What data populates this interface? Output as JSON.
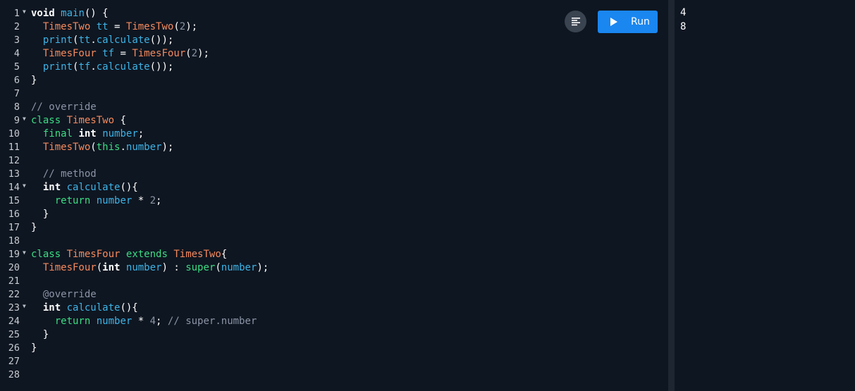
{
  "editor": {
    "lines": [
      {
        "n": "1",
        "fold": true,
        "tokens": [
          [
            "kw",
            "void"
          ],
          [
            "pl",
            " "
          ],
          [
            "fn",
            "main"
          ],
          [
            "pl",
            "() {"
          ]
        ]
      },
      {
        "n": "2",
        "fold": false,
        "tokens": [
          [
            "pl",
            "  "
          ],
          [
            "ty",
            "TimesTwo"
          ],
          [
            "pl",
            " "
          ],
          [
            "id",
            "tt"
          ],
          [
            "pl",
            " = "
          ],
          [
            "ty",
            "TimesTwo"
          ],
          [
            "pl",
            "("
          ],
          [
            "num",
            "2"
          ],
          [
            "pl",
            ");"
          ]
        ]
      },
      {
        "n": "3",
        "fold": false,
        "tokens": [
          [
            "pl",
            "  "
          ],
          [
            "fn",
            "print"
          ],
          [
            "pl",
            "("
          ],
          [
            "id",
            "tt"
          ],
          [
            "pl",
            "."
          ],
          [
            "fn",
            "calculate"
          ],
          [
            "pl",
            "());"
          ]
        ]
      },
      {
        "n": "4",
        "fold": false,
        "tokens": [
          [
            "pl",
            "  "
          ],
          [
            "ty",
            "TimesFour"
          ],
          [
            "pl",
            " "
          ],
          [
            "id",
            "tf"
          ],
          [
            "pl",
            " = "
          ],
          [
            "ty",
            "TimesFour"
          ],
          [
            "pl",
            "("
          ],
          [
            "num",
            "2"
          ],
          [
            "pl",
            ");"
          ]
        ]
      },
      {
        "n": "5",
        "fold": false,
        "tokens": [
          [
            "pl",
            "  "
          ],
          [
            "fn",
            "print"
          ],
          [
            "pl",
            "("
          ],
          [
            "id",
            "tf"
          ],
          [
            "pl",
            "."
          ],
          [
            "fn",
            "calculate"
          ],
          [
            "pl",
            "());"
          ]
        ]
      },
      {
        "n": "6",
        "fold": false,
        "tokens": [
          [
            "pl",
            "}"
          ]
        ]
      },
      {
        "n": "7",
        "fold": false,
        "tokens": []
      },
      {
        "n": "8",
        "fold": false,
        "tokens": [
          [
            "cm",
            "// override"
          ]
        ]
      },
      {
        "n": "9",
        "fold": true,
        "tokens": [
          [
            "kw2",
            "class"
          ],
          [
            "pl",
            " "
          ],
          [
            "ty",
            "TimesTwo"
          ],
          [
            "pl",
            " {"
          ]
        ]
      },
      {
        "n": "10",
        "fold": false,
        "tokens": [
          [
            "pl",
            "  "
          ],
          [
            "kw2",
            "final"
          ],
          [
            "pl",
            " "
          ],
          [
            "kw",
            "int"
          ],
          [
            "pl",
            " "
          ],
          [
            "id",
            "number"
          ],
          [
            "pl",
            ";"
          ]
        ]
      },
      {
        "n": "11",
        "fold": false,
        "tokens": [
          [
            "pl",
            "  "
          ],
          [
            "ty",
            "TimesTwo"
          ],
          [
            "pl",
            "("
          ],
          [
            "kw2",
            "this"
          ],
          [
            "pl",
            "."
          ],
          [
            "id",
            "number"
          ],
          [
            "pl",
            ");"
          ]
        ]
      },
      {
        "n": "12",
        "fold": false,
        "tokens": []
      },
      {
        "n": "13",
        "fold": false,
        "tokens": [
          [
            "pl",
            "  "
          ],
          [
            "cm",
            "// method"
          ]
        ]
      },
      {
        "n": "14",
        "fold": true,
        "tokens": [
          [
            "pl",
            "  "
          ],
          [
            "kw",
            "int"
          ],
          [
            "pl",
            " "
          ],
          [
            "fn",
            "calculate"
          ],
          [
            "pl",
            "(){"
          ]
        ]
      },
      {
        "n": "15",
        "fold": false,
        "tokens": [
          [
            "pl",
            "    "
          ],
          [
            "kw2",
            "return"
          ],
          [
            "pl",
            " "
          ],
          [
            "id",
            "number"
          ],
          [
            "pl",
            " * "
          ],
          [
            "num",
            "2"
          ],
          [
            "pl",
            ";"
          ]
        ]
      },
      {
        "n": "16",
        "fold": false,
        "tokens": [
          [
            "pl",
            "  }"
          ]
        ]
      },
      {
        "n": "17",
        "fold": false,
        "tokens": [
          [
            "pl",
            "}"
          ]
        ]
      },
      {
        "n": "18",
        "fold": false,
        "tokens": []
      },
      {
        "n": "19",
        "fold": true,
        "tokens": [
          [
            "kw2",
            "class"
          ],
          [
            "pl",
            " "
          ],
          [
            "ty",
            "TimesFour"
          ],
          [
            "pl",
            " "
          ],
          [
            "kw2",
            "extends"
          ],
          [
            "pl",
            " "
          ],
          [
            "ty",
            "TimesTwo"
          ],
          [
            "pl",
            "{"
          ]
        ]
      },
      {
        "n": "20",
        "fold": false,
        "tokens": [
          [
            "pl",
            "  "
          ],
          [
            "ty",
            "TimesFour"
          ],
          [
            "pl",
            "("
          ],
          [
            "kw",
            "int"
          ],
          [
            "pl",
            " "
          ],
          [
            "id",
            "number"
          ],
          [
            "pl",
            ") : "
          ],
          [
            "kw2",
            "super"
          ],
          [
            "pl",
            "("
          ],
          [
            "id",
            "number"
          ],
          [
            "pl",
            ");"
          ]
        ]
      },
      {
        "n": "21",
        "fold": false,
        "tokens": []
      },
      {
        "n": "22",
        "fold": false,
        "tokens": [
          [
            "pl",
            "  "
          ],
          [
            "an",
            "@override"
          ]
        ]
      },
      {
        "n": "23",
        "fold": true,
        "tokens": [
          [
            "pl",
            "  "
          ],
          [
            "kw",
            "int"
          ],
          [
            "pl",
            " "
          ],
          [
            "fn",
            "calculate"
          ],
          [
            "pl",
            "(){"
          ]
        ]
      },
      {
        "n": "24",
        "fold": false,
        "tokens": [
          [
            "pl",
            "    "
          ],
          [
            "kw2",
            "return"
          ],
          [
            "pl",
            " "
          ],
          [
            "id",
            "number"
          ],
          [
            "pl",
            " * "
          ],
          [
            "num",
            "4"
          ],
          [
            "pl",
            "; "
          ],
          [
            "cm",
            "// super.number"
          ]
        ]
      },
      {
        "n": "25",
        "fold": false,
        "tokens": [
          [
            "pl",
            "  }"
          ]
        ]
      },
      {
        "n": "26",
        "fold": false,
        "tokens": [
          [
            "pl",
            "}"
          ]
        ]
      },
      {
        "n": "27",
        "fold": false,
        "tokens": []
      },
      {
        "n": "28",
        "fold": false,
        "tokens": []
      }
    ]
  },
  "toolbar": {
    "format_icon": "format-align-icon",
    "run_icon": "play-icon",
    "run_label": "Run"
  },
  "console": {
    "output": [
      "4",
      "8"
    ]
  },
  "colors": {
    "background": "#0e1621",
    "run_button": "#1a86f0",
    "type": "#f58a5e",
    "keyword_green": "#3ddc84",
    "identifier": "#3fb3e6",
    "comment": "#8b94a6"
  }
}
